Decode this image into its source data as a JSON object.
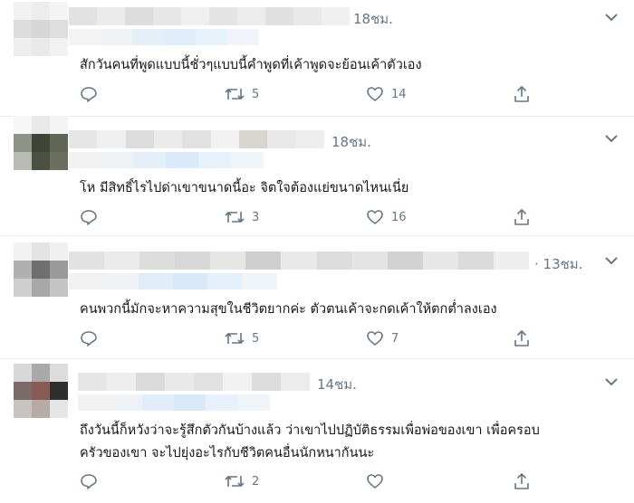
{
  "tweets": [
    {
      "time": "18ชม.",
      "text": [
        "สักวันคนที่พูดแบบนี้ชั่วๆแบบนี้คำพูดที่เค้าพูดจะย้อนเค้าตัวเอง"
      ],
      "retweets": "5",
      "likes": "14"
    },
    {
      "time": "18ชม.",
      "text": [
        "โห มีสิทธิ์ไรไปด่าเขาขนาดนี้อะ จิตใจต้องแย่ขนาดไหนเนี่ย"
      ],
      "retweets": "3",
      "likes": "16"
    },
    {
      "time": "· 13ชม.",
      "text": [
        "คนพวกนี้มักจะหาความสุขในชีวิตยากค่ะ  ตัวตนเค้าจะกดเค้าให้ตกต่ำลงเอง"
      ],
      "retweets": "5",
      "likes": "7"
    },
    {
      "time": "14ชม.",
      "text": [
        "ถึงวันนี้ก็หวังว่าจะรู้สึกตัวกันบ้างแล้ว ว่าเขาไปปฏิบัติธรรมเพื่อพ่อของเขา เพื่อครอบ",
        "ครัวของเขา จะไปยุ่งอะไรกับชีวิตคนอื่นนักหนากันนะ"
      ],
      "retweets": "2",
      "likes": ""
    }
  ],
  "colors": {
    "text": "#14171a",
    "muted": "#657786",
    "divider": "#e6ecf0"
  },
  "icons": [
    "reply-icon",
    "retweet-icon",
    "like-icon",
    "share-icon",
    "chevron-down-icon"
  ]
}
